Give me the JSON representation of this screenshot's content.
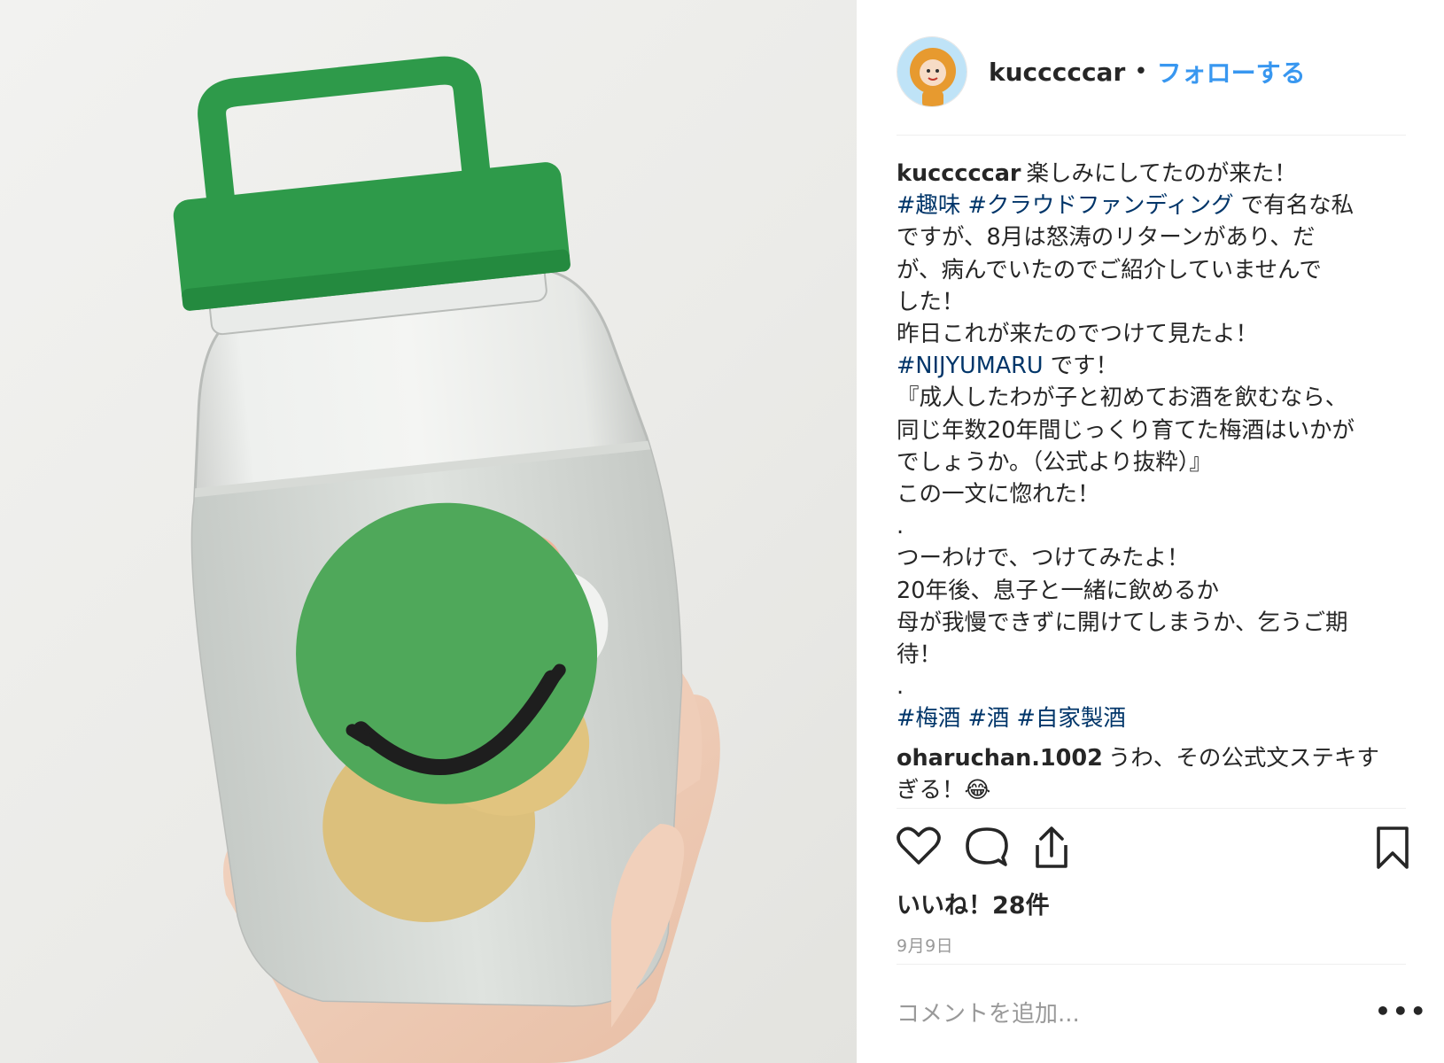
{
  "post": {
    "username": "kucccccar",
    "separator": "•",
    "follow_label": "フォローする",
    "caption_user": "kucccccar",
    "caption": [
      [
        {
          "t": "楽しみにしてたのが来た！"
        }
      ],
      [
        {
          "t": "#趣味",
          "tag": true
        },
        {
          "t": " "
        },
        {
          "t": "#クラウドファンディング",
          "tag": true
        },
        {
          "t": " で有名な私"
        }
      ],
      [
        {
          "t": "ですが、8月は怒涛のリターンがあり、だ"
        }
      ],
      [
        {
          "t": "が、病んでいたのでご紹介していませんで"
        }
      ],
      [
        {
          "t": "した！"
        }
      ],
      [
        {
          "t": "昨日これが来たのでつけて見たよ！"
        }
      ],
      [
        {
          "t": "#NIJYUMARU",
          "tag": true
        },
        {
          "t": " です！"
        }
      ],
      [
        {
          "t": "『成人したわが子と初めてお酒を飲むなら、"
        }
      ],
      [
        {
          "t": "同じ年数20年間じっくり育てた梅酒はいかが"
        }
      ],
      [
        {
          "t": "でしょうか。（公式より抜粋）』"
        }
      ],
      [
        {
          "t": "この一文に惚れた！"
        }
      ],
      [
        {
          "t": "."
        }
      ],
      [
        {
          "t": "つーわけで、つけてみたよ！"
        }
      ],
      [
        {
          "t": "20年後、息子と一緒に飲めるか"
        }
      ],
      [
        {
          "t": "母が我慢できずに開けてしまうか、乞うご期"
        }
      ],
      [
        {
          "t": "待！"
        }
      ],
      [
        {
          "t": "."
        }
      ],
      [
        {
          "t": "#梅酒",
          "tag": true
        },
        {
          "t": " "
        },
        {
          "t": "#酒",
          "tag": true
        },
        {
          "t": " "
        },
        {
          "t": "#自家製酒",
          "tag": true
        }
      ]
    ],
    "comment": {
      "user": "oharuchan.1002",
      "lines": [
        "うわ、その公式文ステキす",
        "ぎる！😂"
      ]
    },
    "likes": "いいね！28件",
    "date": "9月9日",
    "add_comment_placeholder": "コメントを追加...",
    "more_label": "•••",
    "icons": [
      "heart-icon",
      "comment-icon",
      "share-icon",
      "bookmark-icon"
    ]
  },
  "colors": {
    "link": "#3897f0",
    "hashtag": "#003569",
    "text": "#262626",
    "muted": "#999999",
    "border": "#efefef",
    "cap_green": "#2e9a4a",
    "label_green": "#4fa85a"
  }
}
